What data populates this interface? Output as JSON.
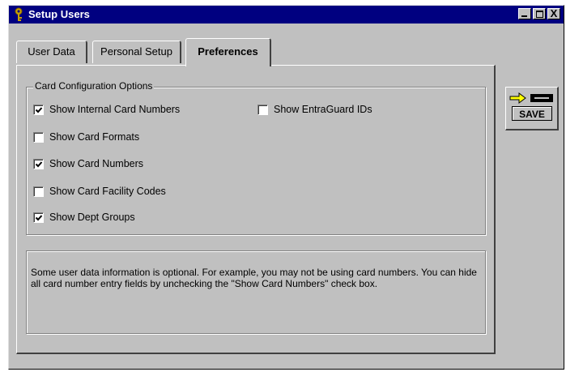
{
  "window": {
    "title": "Setup Users"
  },
  "titlebar_buttons": {
    "close_glyph": "X"
  },
  "tabs": [
    {
      "label": "User Data",
      "active": false
    },
    {
      "label": "Personal Setup",
      "active": false
    },
    {
      "label": "Preferences",
      "active": true
    }
  ],
  "card_config": {
    "legend": "Card Configuration Options",
    "options": [
      {
        "label": "Show Internal Card Numbers",
        "checked": true
      },
      {
        "label": "Show EntraGuard IDs",
        "checked": false
      },
      {
        "label": "Show Card Formats",
        "checked": false
      },
      {
        "label": "Show Card Numbers",
        "checked": true
      },
      {
        "label": "Show Card Facility Codes",
        "checked": false
      },
      {
        "label": "Show Dept Groups",
        "checked": true
      }
    ]
  },
  "info": {
    "text": "Some user data information is optional.  For example, you may not be using card numbers.  You can hide all card number entry fields by unchecking the \"Show Card Numbers\" check box."
  },
  "toolbar": {
    "save_label": "SAVE"
  },
  "colors": {
    "titlebar": "#000080",
    "face": "#c0c0c0",
    "arrow_icon": "#ffff00"
  }
}
